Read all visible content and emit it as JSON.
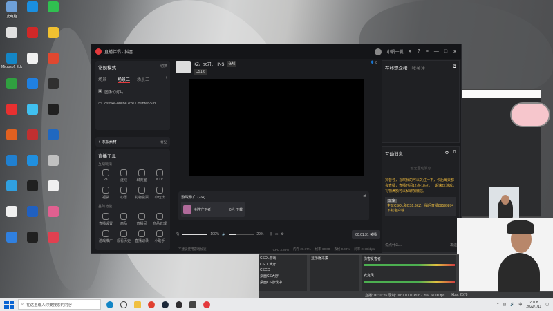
{
  "desktop": {
    "icons": [
      {
        "label": "此电脑",
        "color": "#6ea0d8"
      },
      {
        "label": "",
        "color": "#1a8fe0"
      },
      {
        "label": "",
        "color": "#30c050"
      },
      {
        "label": "",
        "color": "#e0e0e0"
      },
      {
        "label": "",
        "color": "#d02828"
      },
      {
        "label": "",
        "color": "#f0c030"
      },
      {
        "label": "Microsoft Edge",
        "color": "#1486c6"
      },
      {
        "label": "",
        "color": "#f0f0f0"
      },
      {
        "label": "",
        "color": "#e04830"
      },
      {
        "label": "",
        "color": "#30a040"
      },
      {
        "label": "",
        "color": "#2080e0"
      },
      {
        "label": "",
        "color": "#303030"
      },
      {
        "label": "",
        "color": "#e83030"
      },
      {
        "label": "",
        "color": "#40c0f0"
      },
      {
        "label": "",
        "color": "#202020"
      },
      {
        "label": "",
        "color": "#e06020"
      },
      {
        "label": "",
        "color": "#c03030"
      },
      {
        "label": "",
        "color": "#2068c0"
      },
      {
        "label": "",
        "color": "#2080d0"
      },
      {
        "label": "",
        "color": "#2090e0"
      },
      {
        "label": "",
        "color": "#c0c0c0"
      },
      {
        "label": "",
        "color": "#30a0e0"
      },
      {
        "label": "",
        "color": "#202020"
      },
      {
        "label": "",
        "color": "#f0f0f0"
      },
      {
        "label": "",
        "color": "#f0f0f0"
      },
      {
        "label": "",
        "color": "#2060c0"
      },
      {
        "label": "",
        "color": "#e06090"
      },
      {
        "label": "",
        "color": "#3080e0"
      },
      {
        "label": "",
        "color": "#202020"
      },
      {
        "label": "",
        "color": "#e04050"
      }
    ]
  },
  "app": {
    "title": "直播伴侣 · 抖音",
    "user": "小帆一帆",
    "left": {
      "mode_title": "常规模式",
      "mode_switch": "切换",
      "scene_tabs": [
        "场景一",
        "场景二",
        "场景三"
      ],
      "sources": [
        {
          "label": "图像幻灯片"
        },
        {
          "label": "cstrike-online.exe Counter-Stri..."
        }
      ],
      "add_source": "添加素材",
      "clear": "清空",
      "tools_title": "直播工具",
      "interactive_title": "互动玩法",
      "interactive_tools": [
        "PK",
        "连线",
        "聊天室",
        "KTV",
        "福袋",
        "心愿",
        "礼物投票",
        "小玩法"
      ],
      "basic_title": "基础功能",
      "basic_tools": [
        "直播设置",
        "商品",
        "直播间",
        "商品管理",
        "游戏推广",
        "观看历史",
        "直播记录",
        "小助手"
      ]
    },
    "center": {
      "streamer_name": "KZ、大刀、HNS",
      "streamer_tag": "CS1.6",
      "status": "在线",
      "promo_title": "游戏推广 (2/4)",
      "promo_item": "决胜守卫者",
      "promo_count": "0人 下载",
      "mic_volume": "100%",
      "speaker_volume": "29%",
      "timer": "00:01:31",
      "end_live": "关播",
      "status_text": "不建议使用游戏加速",
      "cpu": "CPU 3.86%",
      "mem": "内存 26.77%",
      "fps": "帧率 60.00",
      "drop": "丢帧 0.00%",
      "bitrate": "码率 2178kbps",
      "viewers": "8"
    },
    "right": {
      "audience_tab": "在线观众榜",
      "fans_tab": "我关注",
      "interaction_title": "互动消息",
      "notice": "暂无互动消息",
      "announce": "抖音号，喜欢我的可以关注一下，今后每天都会直播，直播时间12点-18点，一起来玩游戏，礼物满额可以私聊加微信。",
      "msg_user": "玩家",
      "msg_text": "主玩CSOL和CS1.6KZ，稍后直播89599874下载客户端",
      "chat_placeholder": "说点什么...",
      "send": "发送"
    }
  },
  "obs": {
    "scenes": [
      "CSOL游戏",
      "CSOL大厅",
      "CSGO",
      "桌面CS大厅",
      "桌面CS游戏中"
    ],
    "sources": [
      "显示器采集"
    ],
    "mixer": [
      "伤害受害者",
      "麦克风"
    ],
    "status": "直播: 00:01:26  录制: 00:00:00  CPU: 7.3%, 60.00 fps",
    "kbps": "kb/s: 2578"
  },
  "taskbar": {
    "search_placeholder": "在这里输入你要搜索的内容",
    "time": "20:08",
    "date": "2022/7/11",
    "lang": "中"
  }
}
